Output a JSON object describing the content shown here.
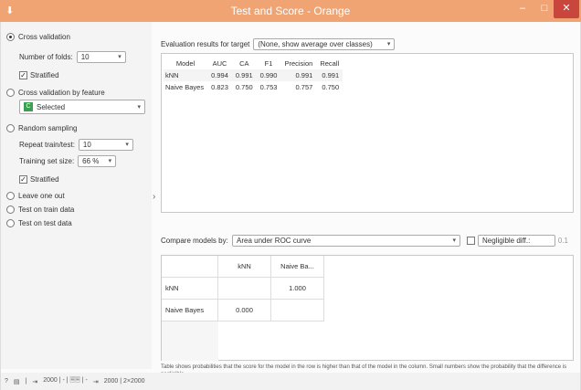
{
  "window": {
    "title": "Test and Score - Orange",
    "app_icon": "orange-app-icon",
    "minimize": "–",
    "maximize": "□",
    "close": "✕",
    "title_bg": "#f0a474",
    "close_bg": "#c8463c"
  },
  "sampling": {
    "cross_validation": "Cross validation",
    "number_of_folds_label": "Number of folds:",
    "number_of_folds_value": "10",
    "stratified_1": "Stratified",
    "cv_by_feature": "Cross validation by feature",
    "feature_selected": "Selected",
    "random_sampling": "Random sampling",
    "repeat_label": "Repeat train/test:",
    "repeat_value": "10",
    "training_size_label": "Training set size:",
    "training_size_value": "66 %",
    "stratified_2": "Stratified",
    "leave_one_out": "Leave one out",
    "test_on_train": "Test on train data",
    "test_on_test": "Test on test data",
    "selected_option": "Cross validation"
  },
  "evaluation": {
    "label": "Evaluation results for target",
    "target_value": "(None, show average over classes)",
    "columns": [
      "Model",
      "AUC",
      "CA",
      "F1",
      "Precision",
      "Recall"
    ],
    "rows": [
      {
        "model": "kNN",
        "auc": "0.994",
        "ca": "0.991",
        "f1": "0.990",
        "precision": "0.991",
        "recall": "0.991"
      },
      {
        "model": "Naive Bayes",
        "auc": "0.823",
        "ca": "0.750",
        "f1": "0.753",
        "precision": "0.757",
        "recall": "0.750"
      }
    ]
  },
  "compare": {
    "label": "Compare models by:",
    "metric": "Area under ROC curve",
    "negligible_label": "Negligible diff.:",
    "rope_value": "0.1",
    "col_headers": [
      "kNN",
      "Naive Ba..."
    ],
    "row_headers": [
      "kNN",
      "Naive Bayes"
    ],
    "cells": {
      "knn_vs_nb": "1.000",
      "nb_vs_knn": "0.000"
    }
  },
  "note": "Table shows probabilities that the score for the model in the row is higher than that of the model in the column. Small numbers show the probability that the difference is negligible.",
  "status": {
    "help": "?",
    "report": "▤",
    "input_summary": "2000 | - | 🗏🗏 | -",
    "output_summary": "2000 | 2×2000"
  }
}
